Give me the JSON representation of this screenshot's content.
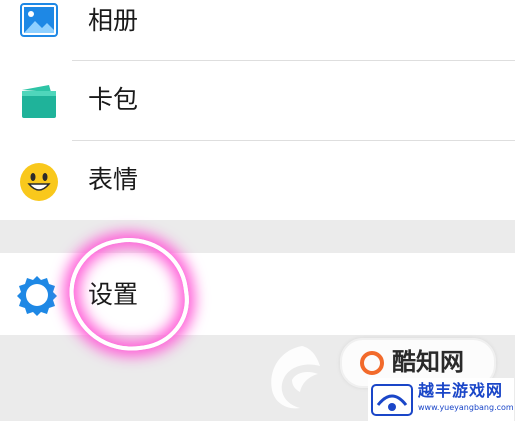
{
  "menu": {
    "items": [
      {
        "label": "相册",
        "icon": "photo-album-icon"
      },
      {
        "label": "卡包",
        "icon": "wallet-icon"
      },
      {
        "label": "表情",
        "icon": "smiley-icon"
      },
      {
        "label": "设置",
        "icon": "gear-icon"
      }
    ]
  },
  "watermark": {
    "badge_text": "酷知网",
    "site_name": "越丰游戏网",
    "site_url": "www.yueyangbang.com"
  },
  "colors": {
    "accent_blue": "#1e88e5",
    "highlight": "#ff5fd8",
    "smiley_yellow": "#f9c81c",
    "wallet_teal": "#1fb39a"
  }
}
